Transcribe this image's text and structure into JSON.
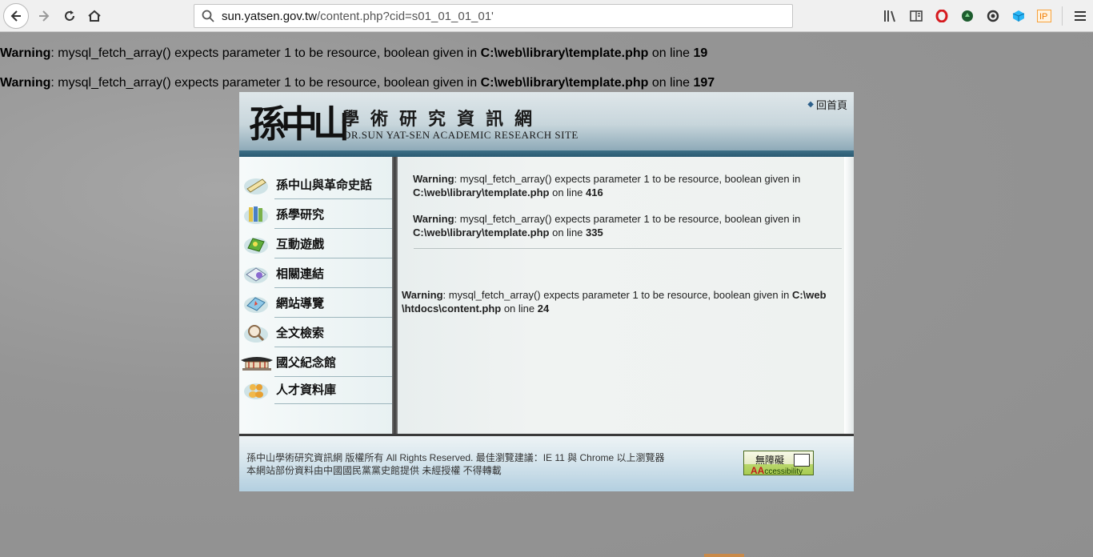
{
  "browser": {
    "url_domain": "sun.yatsen.gov.tw",
    "url_path": "/content.php?cid=s01_01_01_01'"
  },
  "php_warnings_top": [
    {
      "label": "Warning",
      "message": ": mysql_fetch_array() expects parameter 1 to be resource, boolean given in ",
      "path": "C:\\web\\library\\template.php",
      "line_text": " on line ",
      "line": "19"
    },
    {
      "label": "Warning",
      "message": ": mysql_fetch_array() expects parameter 1 to be resource, boolean given in ",
      "path": "C:\\web\\library\\template.php",
      "line_text": " on line ",
      "line": "197"
    }
  ],
  "site": {
    "logo": "孫中山",
    "title": "學術研究資訊網",
    "subtitle": "DR.SUN YAT-SEN ACADEMIC RESEARCH SITE",
    "home_link": "回首頁"
  },
  "nav": {
    "items": [
      {
        "label": "孫中山與革命史話",
        "icon": "scroll-icon"
      },
      {
        "label": "孫學研究",
        "icon": "books-icon"
      },
      {
        "label": "互動遊戲",
        "icon": "game-icon"
      },
      {
        "label": "相關連結",
        "icon": "link-icon"
      },
      {
        "label": "網站導覽",
        "icon": "map-icon"
      },
      {
        "label": "全文檢索",
        "icon": "search-person-icon"
      },
      {
        "label": "國父紀念館",
        "icon": "memorial-hall-icon"
      },
      {
        "label": "人才資料庫",
        "icon": "people-icon"
      }
    ]
  },
  "content_warnings": [
    {
      "label": "Warning",
      "message": ": mysql_fetch_array() expects parameter 1 to be resource, boolean given in",
      "path": "C:\\web\\library\\template.php",
      "line_text": " on line ",
      "line": "416"
    },
    {
      "label": "Warning",
      "message": ": mysql_fetch_array() expects parameter 1 to be resource, boolean given in",
      "path": "C:\\web\\library\\template.php",
      "line_text": " on line ",
      "line": "335"
    },
    {
      "label": "Warning",
      "message": ": mysql_fetch_array() expects parameter 1 to be resource, boolean given in ",
      "path1": "C:\\web",
      "path2": "\\htdocs\\content.php",
      "line_text": " on line ",
      "line": "24"
    }
  ],
  "footer": {
    "line1": "孫中山學術研究資訊網 版權所有 All Rights Reserved. 最佳瀏覽建議：IE 11 與 Chrome 以上瀏覽器",
    "line2": "本網站部份資料由中國國民黨黨史館提供 未經授權 不得轉載",
    "badge_top": "無障礙",
    "badge_aa": "AA",
    "badge_rest": "ccessibility"
  },
  "colors": {
    "accent_stripe": "#2a5a72",
    "badge_green": "#a9cc52"
  }
}
